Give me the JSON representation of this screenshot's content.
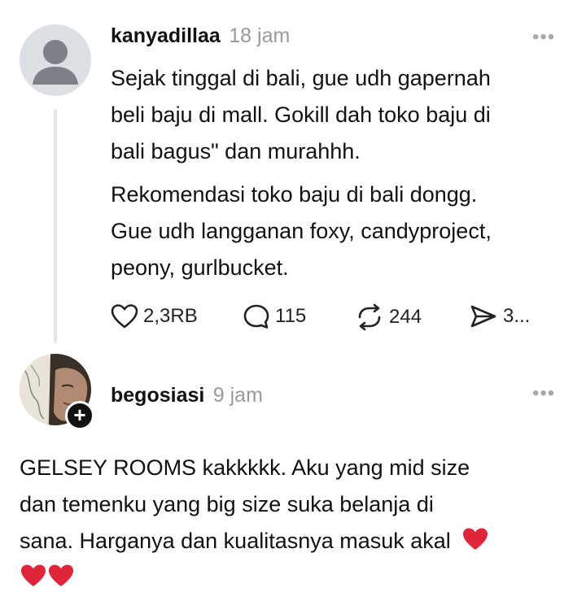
{
  "post": {
    "username": "kanyadillaa",
    "time": "18 jam",
    "more_label": "•••",
    "paragraph1_lines": [
      "Sejak tinggal di bali, gue udh gapernah",
      "beli baju di mall. Gokill dah toko baju di",
      "bali bagus\" dan murahhh."
    ],
    "paragraph2_lines": [
      "Rekomendasi toko baju di bali dongg.",
      "Gue udh langganan foxy, candyproject,",
      "peony, gurlbucket."
    ],
    "stats": {
      "likes": "2,3RB",
      "comments": "115",
      "reposts": "244",
      "shares": "3..."
    }
  },
  "reply": {
    "username": "begosiasi",
    "time": "9 jam",
    "more_label": "•••",
    "follow_label": "+",
    "text_lines": [
      "GELSEY ROOMS kakkkkk. Aku yang mid size",
      "dan temenku yang big size suka belanja di",
      "sana. Harganya dan kualitasnya masuk akal"
    ]
  },
  "icons": {
    "like": "heart-outline-icon",
    "comment": "speech-bubble-icon",
    "repost": "repost-arrows-icon",
    "share": "send-icon",
    "emoji": "red-heart-emoji"
  },
  "colors": {
    "heart_emoji": "#e0253b",
    "muted": "#9a9a9a",
    "line": "#e4e6e8"
  }
}
